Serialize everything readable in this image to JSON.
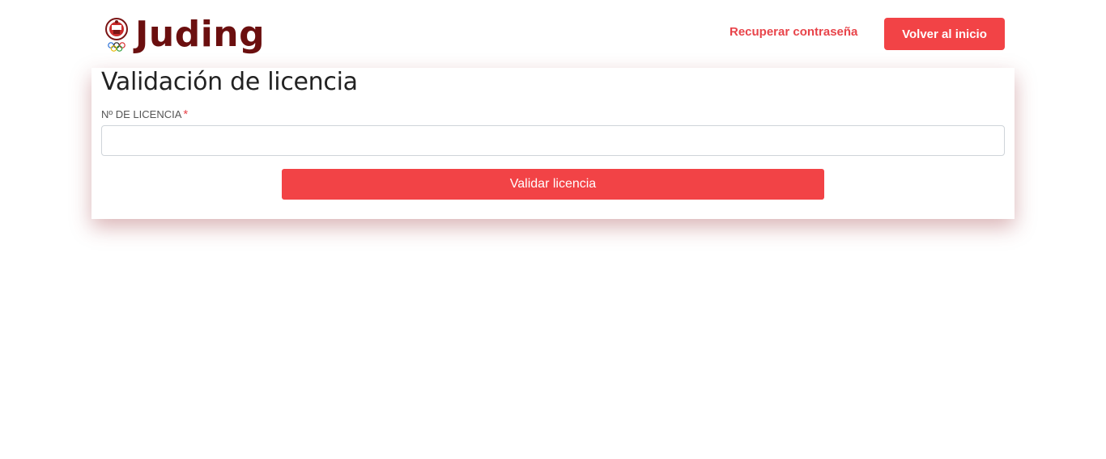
{
  "brand": {
    "name": "Juding",
    "logo_icon": "judo-federation-emblem-icon"
  },
  "nav": {
    "recover_password": "Recuperar contraseña",
    "back_home": "Volver al inicio"
  },
  "form": {
    "title": "Validación de licencia",
    "license_label": "Nº DE LICENCIA",
    "required_mark": "*",
    "license_value": "",
    "submit_label": "Validar licencia"
  },
  "colors": {
    "accent": "#f24346",
    "brand_text": "#6b0f0f",
    "link": "#e8444a"
  }
}
